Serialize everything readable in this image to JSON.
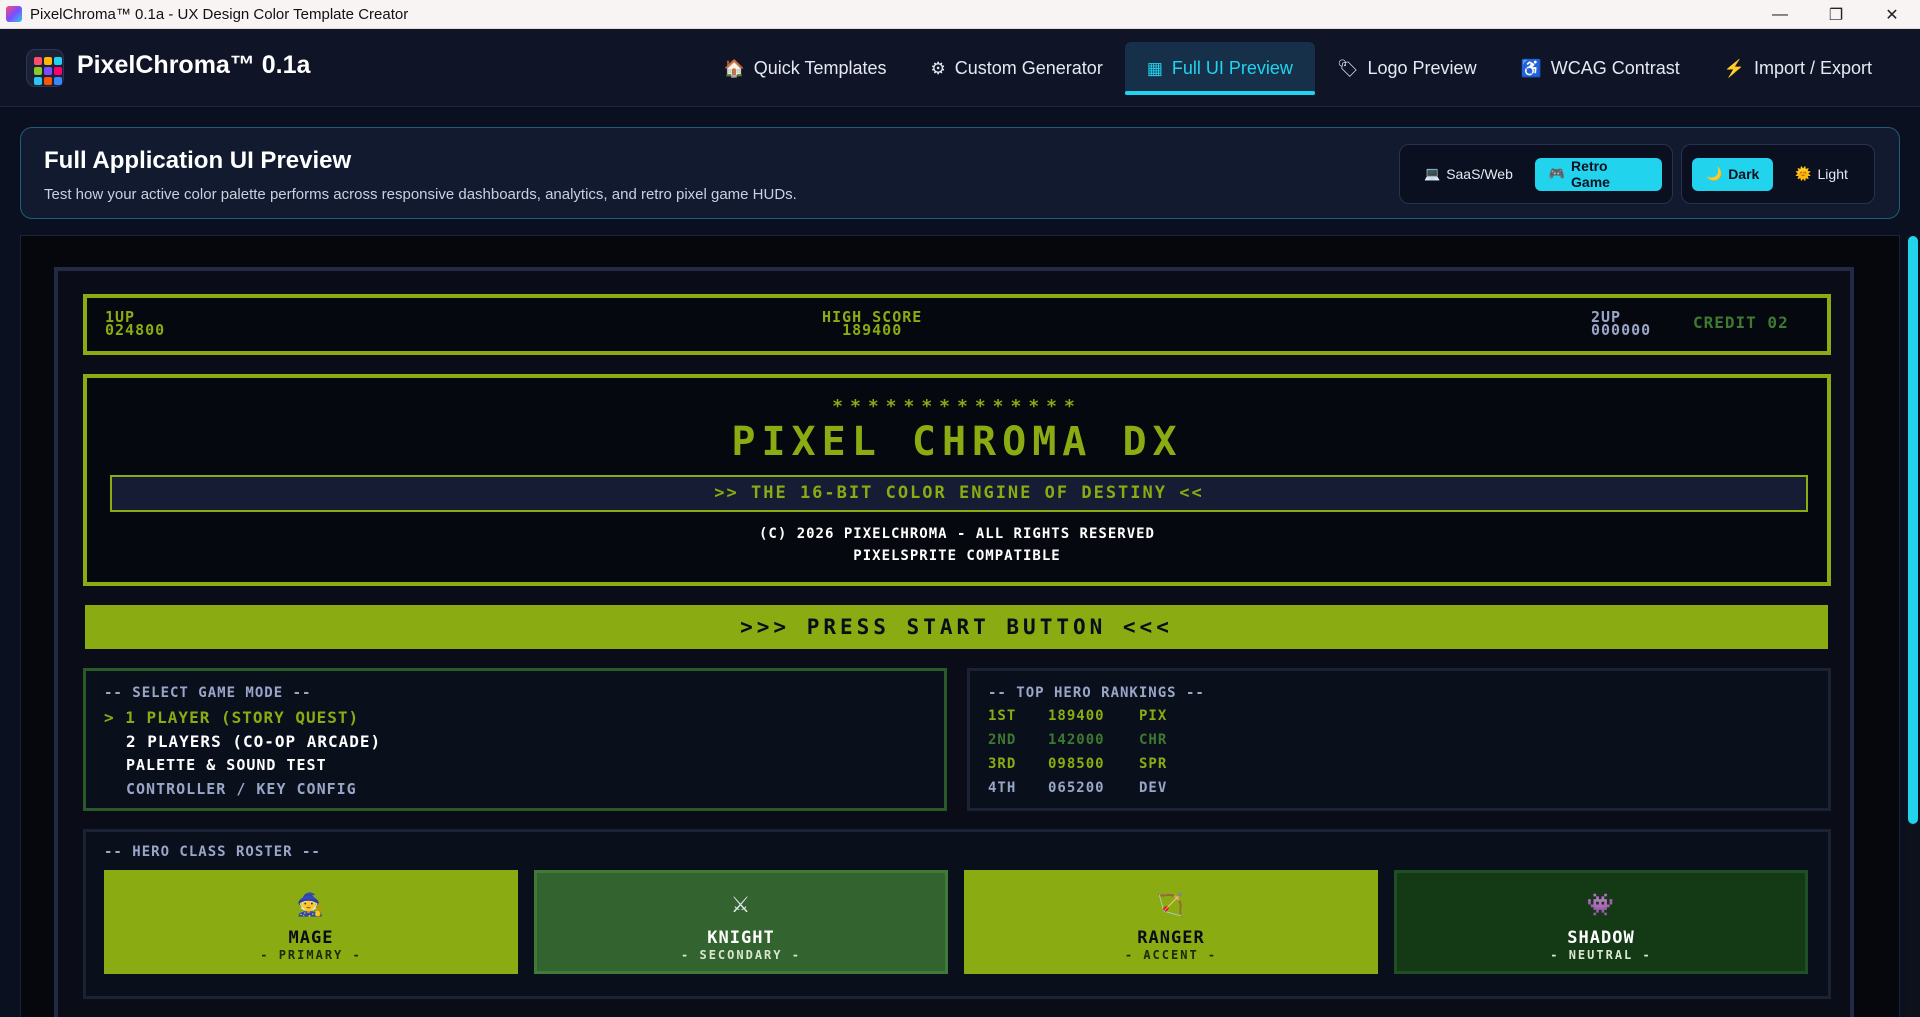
{
  "window": {
    "title": "PixelChroma™ 0.1a - UX Design Color Template Creator",
    "controls": [
      "—",
      "❐",
      "✕"
    ]
  },
  "app": {
    "brand": "PixelChroma™ 0.1a",
    "logo_colors": [
      "#ff4d6d",
      "#ffb703",
      "#22d3ee",
      "#8ac926",
      "#7c4dff",
      "#ff006e",
      "#2ec4f1",
      "#fb5607",
      "#3a86ff"
    ]
  },
  "nav": {
    "tabs": [
      {
        "label": "Quick Templates",
        "icon": "🏠"
      },
      {
        "label": "Custom Generator",
        "icon": "⚙"
      },
      {
        "label": "Full UI Preview",
        "icon": "▦",
        "active": true
      },
      {
        "label": "Logo Preview",
        "icon": "🏷"
      },
      {
        "label": "WCAG Contrast",
        "icon": "♿"
      },
      {
        "label": "Import / Export",
        "icon": "⚡"
      }
    ]
  },
  "header": {
    "title": "Full Application UI Preview",
    "subtitle": "Test how your active color palette performs across responsive dashboards, analytics, and retro pixel game HUDs.",
    "mode_toggle": {
      "saas": "SaaS/Web",
      "retro": "Retro Game",
      "selected": "Retro Game"
    },
    "theme_toggle": {
      "dark": "Dark",
      "light": "Light",
      "selected": "Dark"
    }
  },
  "game": {
    "hud": {
      "p1_label": "1UP",
      "p1_score": "024800",
      "hi_label": "HIGH SCORE",
      "hi_score": "189400",
      "p2_label": "2UP",
      "p2_score": "000000",
      "credit": "CREDIT 02"
    },
    "title_screen": {
      "stars": "**************",
      "title": "PIXEL CHROMA DX",
      "tagline": ">> THE 16-BIT COLOR ENGINE OF DESTINY <<",
      "copyright": "(C) 2026 PIXELCHROMA - ALL RIGHTS RESERVED",
      "compat": "PIXELSPRITE COMPATIBLE"
    },
    "start_button": ">>>  PRESS START BUTTON  <<<",
    "mode_menu": {
      "header": "-- SELECT GAME MODE --",
      "items": [
        "> 1 PLAYER (STORY QUEST)",
        "2 PLAYERS (CO-OP ARCADE)",
        "PALETTE & SOUND TEST",
        "CONTROLLER / KEY CONFIG"
      ],
      "selected_index": 0
    },
    "rankings": {
      "header": "-- TOP HERO RANKINGS --",
      "rows": [
        {
          "rank": "1ST",
          "score": "189400",
          "name": "PIX"
        },
        {
          "rank": "2ND",
          "score": "142000",
          "name": "CHR"
        },
        {
          "rank": "3RD",
          "score": "098500",
          "name": "SPR"
        },
        {
          "rank": "4TH",
          "score": "065200",
          "name": "DEV"
        }
      ]
    },
    "roster": {
      "header": "-- HERO CLASS ROSTER --",
      "classes": [
        {
          "name": "MAGE",
          "role": "- PRIMARY -",
          "icon": "🧙",
          "color": "#8aab12"
        },
        {
          "name": "KNIGHT",
          "role": "- SECONDARY -",
          "icon": "⚔",
          "color": "#33632e"
        },
        {
          "name": "RANGER",
          "role": "- ACCENT -",
          "icon": "🏹",
          "color": "#8aab12"
        },
        {
          "name": "SHADOW",
          "role": "- NEUTRAL -",
          "icon": "👾",
          "color": "#133a14"
        }
      ]
    },
    "palette": {
      "primary": "#8aab12",
      "secondary": "#33632e",
      "accent": "#22d3ee",
      "neutral": "#133a14"
    }
  }
}
